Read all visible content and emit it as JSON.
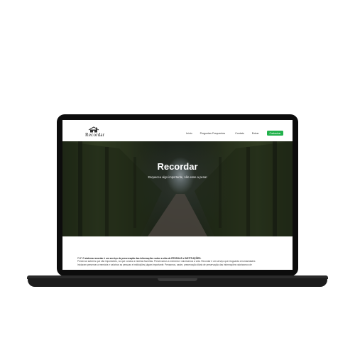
{
  "site": {
    "logo_text": "Recordar",
    "nav": {
      "items": [
        "Início",
        "Perguntas Frequentes",
        "Contato",
        "Entrar"
      ],
      "cta": "Cadastrar"
    }
  },
  "hero": {
    "title": "Recordar",
    "subtitle": "Esqueceu algo importante, não esse a pena!"
  },
  "content": {
    "lead_prefix": "PHP",
    "lead_bold": "O sistema recordar é um serviço de preservação das informações sobre a vida de PESSOAS e INSTITUIÇÕES.",
    "line2": "Preservar saberes que são importantes, no que conduz a estórias favoritas. Preservamos a memória e valorizamos a vida. Recordar é um serviço que resguarda a humanidades",
    "line3": "Iniciaram preservar a memória e valorizar as pessoas e instituições julgam importante. Pensamos, assim, preservação diária de preservação das informações valorizamos de"
  },
  "colors": {
    "cta": "#22b14c",
    "laptop_body": "#0c0c0c"
  }
}
